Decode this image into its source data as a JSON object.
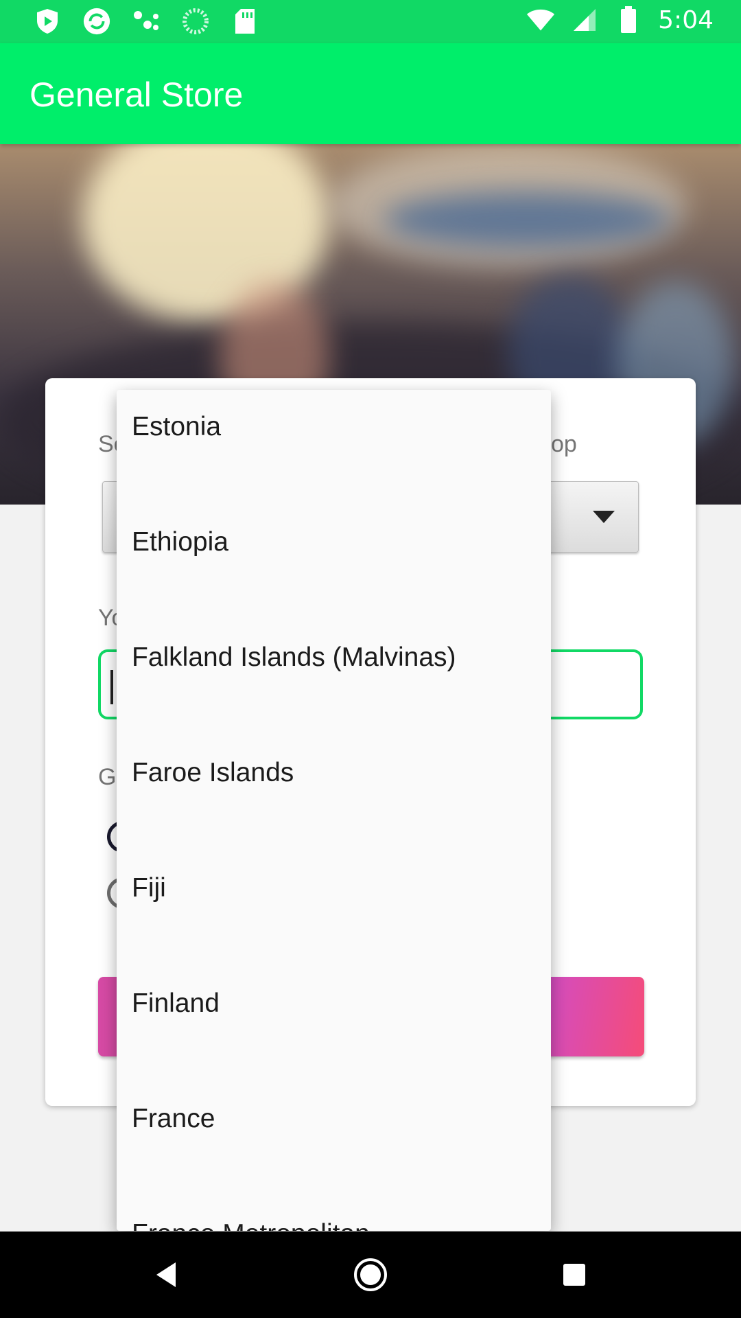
{
  "status_bar": {
    "time": "5:04",
    "left_icons": [
      "play-shield-icon",
      "sync-icon",
      "dots-icon",
      "loading-icon",
      "sd-card-icon"
    ],
    "right_icons": [
      "wifi-icon",
      "signal-icon",
      "battery-icon"
    ]
  },
  "app_bar": {
    "title": "General Store"
  },
  "card": {
    "country_label_partial_left": "Se",
    "country_label_partial_right": "op",
    "name_label_partial": "Yo",
    "gender_label_partial": "Ge"
  },
  "dropdown": {
    "items": [
      "Estonia",
      "Ethiopia",
      "Falkland Islands (Malvinas)",
      "Faroe Islands",
      "Fiji",
      "Finland",
      "France",
      "France Metropolitan"
    ]
  },
  "colors": {
    "status_bar": "#11D965",
    "app_bar": "#00EE6A",
    "accent": "#11D965",
    "button_gradient_start": "#D64AA5",
    "button_gradient_end": "#F54C78"
  },
  "nav_bar": {
    "buttons": [
      "back-icon",
      "home-icon",
      "recents-icon"
    ]
  }
}
